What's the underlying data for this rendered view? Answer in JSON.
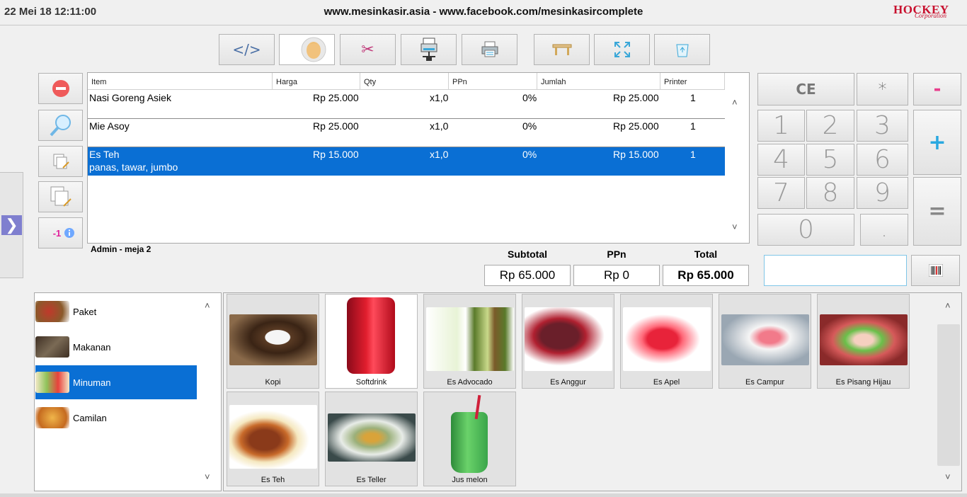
{
  "header": {
    "datetime": "22 Mei 18 12:11:00",
    "site_title": "www.mesinkasir.asia - www.facebook.com/mesinkasircomplete",
    "brand": "HOCKEY",
    "brand_sub": "Corporation"
  },
  "toolbar": {
    "buttons": [
      {
        "name": "code-icon",
        "glyph": "</>"
      },
      {
        "name": "user-avatar-icon",
        "glyph": "face"
      },
      {
        "name": "scissors-icon",
        "glyph": "✂"
      },
      {
        "name": "network-printer-icon",
        "glyph": "printer-net"
      },
      {
        "name": "printer-icon",
        "glyph": "printer"
      },
      {
        "name": "table-icon",
        "glyph": "table"
      },
      {
        "name": "fullscreen-icon",
        "glyph": "expand"
      },
      {
        "name": "recycle-bin-icon",
        "glyph": "bin"
      }
    ]
  },
  "left_tools": {
    "minus_badge": "-1"
  },
  "order": {
    "columns": [
      "Item",
      "Harga",
      "Qty",
      "PPn",
      "Jumlah",
      "Printer"
    ],
    "rows": [
      {
        "item": "Nasi Goreng Asiek",
        "harga": "Rp 25.000",
        "qty": "x1,0",
        "ppn": "0%",
        "jumlah": "Rp 25.000",
        "printer": "1",
        "note": ""
      },
      {
        "item": "Mie Asoy",
        "harga": "Rp 25.000",
        "qty": "x1,0",
        "ppn": "0%",
        "jumlah": "Rp 25.000",
        "printer": "1",
        "note": ""
      },
      {
        "item": "Es Teh",
        "harga": "Rp 15.000",
        "qty": "x1,0",
        "ppn": "0%",
        "jumlah": "Rp 15.000",
        "printer": "1",
        "note": "panas, tawar, jumbo"
      }
    ],
    "selected_index": 2,
    "admin_label": "Admin - meja 2"
  },
  "totals": {
    "subtotal_label": "Subtotal",
    "ppn_label": "PPn",
    "total_label": "Total",
    "subtotal": "Rp 65.000",
    "ppn": "Rp 0",
    "total": "Rp 65.000"
  },
  "keypad": {
    "ce": "CE",
    "star": "*",
    "minus": "-",
    "plus": "+",
    "equals": "=",
    "dot": ".",
    "digits": [
      "1",
      "2",
      "3",
      "4",
      "5",
      "6",
      "7",
      "8",
      "9",
      "0"
    ],
    "accent_minus": "#e83e8c",
    "accent_plus": "#29a8e0"
  },
  "categories": [
    {
      "label": "Paket",
      "color": "#8a5a2b"
    },
    {
      "label": "Makanan",
      "color": "#5b4a3a"
    },
    {
      "label": "Minuman",
      "color": "#8fc35a"
    },
    {
      "label": "Camilan",
      "color": "#d99a3a"
    }
  ],
  "selected_category": 2,
  "products": [
    {
      "label": "Kopi",
      "color": "#5a3b24"
    },
    {
      "label": "Softdrink",
      "color": "#c8102e"
    },
    {
      "label": "Es Advocado",
      "color": "#7fa64a"
    },
    {
      "label": "Es Anggur",
      "color": "#6a1f2a"
    },
    {
      "label": "Es Apel",
      "color": "#d4233a"
    },
    {
      "label": "Es Campur",
      "color": "#c9b7a8"
    },
    {
      "label": "Es Pisang Hijau",
      "color": "#d65a5a"
    },
    {
      "label": "Es Teh",
      "color": "#8a3a1a"
    },
    {
      "label": "Es Teller",
      "color": "#9bb07a"
    },
    {
      "label": "Jus melon",
      "color": "#4caf50"
    }
  ]
}
